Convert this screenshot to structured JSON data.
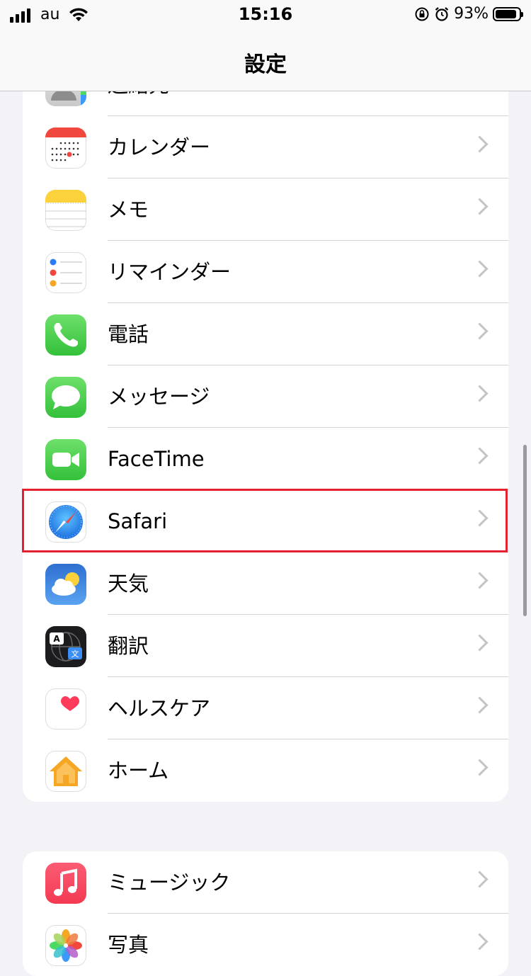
{
  "status_bar": {
    "carrier": "au",
    "time": "15:16",
    "battery_percent": "93%",
    "battery_level": 0.93
  },
  "nav": {
    "title": "設定"
  },
  "group1": {
    "items": [
      {
        "label": "連絡先",
        "icon": "contacts-icon"
      },
      {
        "label": "カレンダー",
        "icon": "calendar-icon"
      },
      {
        "label": "メモ",
        "icon": "notes-icon"
      },
      {
        "label": "リマインダー",
        "icon": "reminders-icon"
      },
      {
        "label": "電話",
        "icon": "phone-icon"
      },
      {
        "label": "メッセージ",
        "icon": "messages-icon"
      },
      {
        "label": "FaceTime",
        "icon": "facetime-icon"
      },
      {
        "label": "Safari",
        "icon": "safari-icon"
      },
      {
        "label": "天気",
        "icon": "weather-icon"
      },
      {
        "label": "翻訳",
        "icon": "translate-icon"
      },
      {
        "label": "ヘルスケア",
        "icon": "health-icon"
      },
      {
        "label": "ホーム",
        "icon": "home-icon"
      }
    ]
  },
  "group2": {
    "items": [
      {
        "label": "ミュージック",
        "icon": "music-icon"
      },
      {
        "label": "写真",
        "icon": "photos-icon"
      }
    ]
  },
  "highlight_target": "Safari"
}
